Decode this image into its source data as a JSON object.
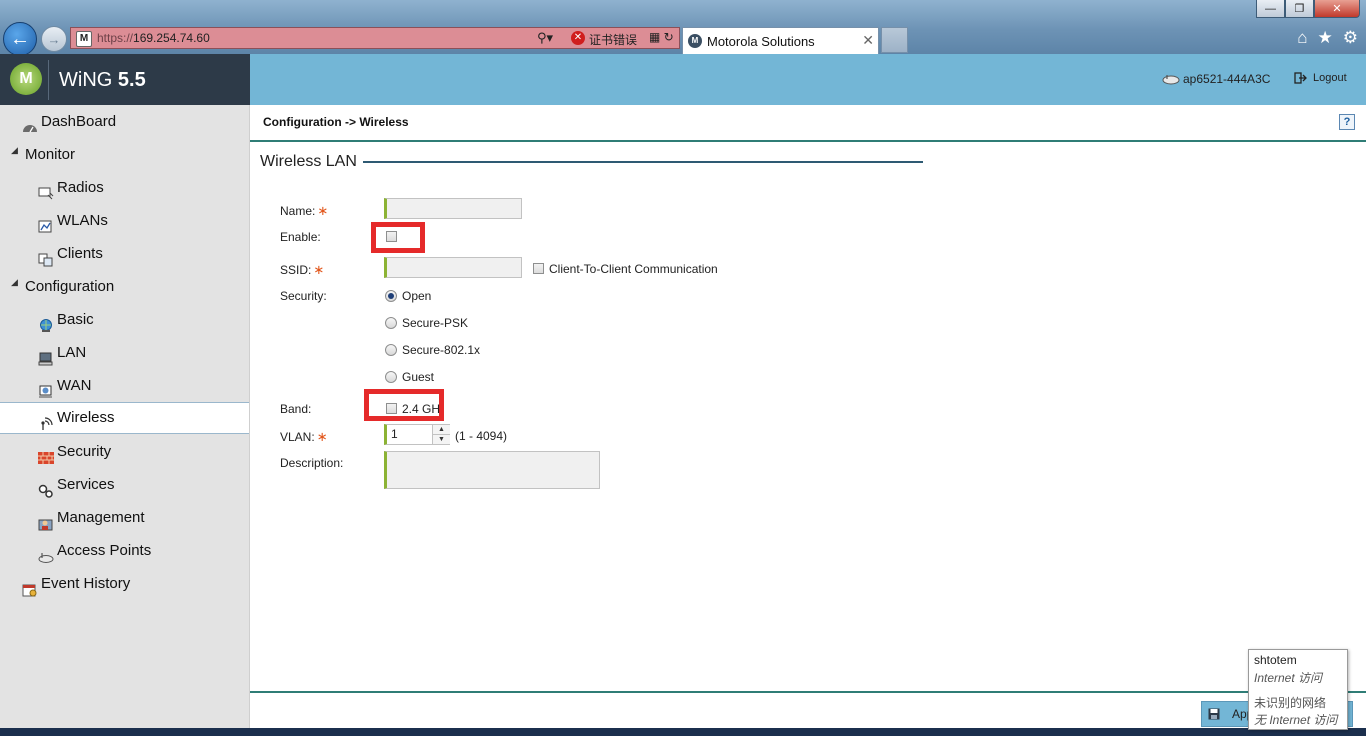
{
  "browser": {
    "url_scheme": "https://",
    "url_host": "169.254.74.60",
    "cert_error": "证书错误",
    "tab_title": "Motorola Solutions"
  },
  "app": {
    "title_main": "WiNG",
    "title_version": "5.5",
    "device_name": "ap6521-444A3C",
    "logout_label": "Logout"
  },
  "sidebar": {
    "dashboard": "DashBoard",
    "monitor_group": "Monitor",
    "monitor_items": [
      "Radios",
      "WLANs",
      "Clients"
    ],
    "configuration_group": "Configuration",
    "configuration_items": [
      "Basic",
      "LAN",
      "WAN",
      "Wireless",
      "Security",
      "Services",
      "Management",
      "Access Points"
    ],
    "event_history": "Event History",
    "active_item": "Wireless"
  },
  "breadcrumb": "Configuration -> Wireless",
  "help_label": "?",
  "section_title": "Wireless LAN",
  "form": {
    "name_label": "Name:",
    "name_value": "",
    "enable_label": "Enable:",
    "enable_checked": false,
    "ssid_label": "SSID:",
    "ssid_value": "",
    "client_to_client_label": "Client-To-Client Communication",
    "client_to_client_checked": false,
    "security_label": "Security:",
    "security_options": [
      "Open",
      "Secure-PSK",
      "Secure-802.1x",
      "Guest"
    ],
    "security_selected": "Open",
    "band_label": "Band:",
    "band_option": "2.4 GH",
    "band_checked": false,
    "vlan_label": "VLAN:",
    "vlan_value": "1",
    "vlan_range": "(1 - 4094)",
    "description_label": "Description:",
    "description_value": ""
  },
  "footer": {
    "apply_label": "App"
  },
  "network_tooltip": {
    "line1": "shtotem",
    "line2": "Internet 访问",
    "line3": "未识别的网络",
    "line4": "无 Internet 访问"
  },
  "colors": {
    "brand_bg": "#2d3a48",
    "header_bg": "#73b6d6",
    "accent_teal": "#2f7d76",
    "required_star": "#e2561b",
    "highlight_red": "#e52a2a",
    "input_accent": "#8cb334"
  }
}
